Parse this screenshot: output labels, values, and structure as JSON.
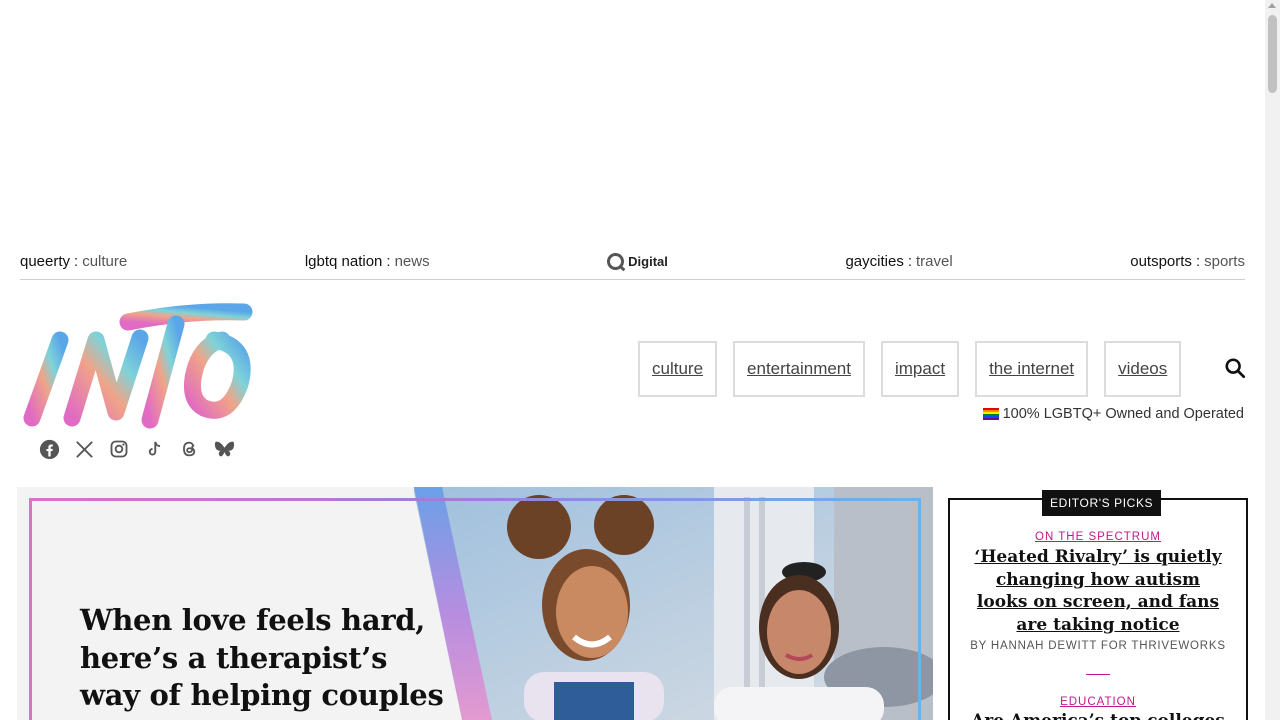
{
  "network": [
    {
      "brand": "queerty",
      "topic": "culture"
    },
    {
      "brand": "lgbtq nation",
      "topic": "news"
    },
    {
      "brand": "gaycities",
      "topic": "travel"
    },
    {
      "brand": "outsports",
      "topic": "sports"
    }
  ],
  "qdigital": {
    "text": "Digital"
  },
  "logo": {
    "text": "INTO"
  },
  "socials": [
    "facebook-icon",
    "x-icon",
    "instagram-icon",
    "tiktok-icon",
    "threads-icon",
    "bluesky-icon"
  ],
  "nav": {
    "items": [
      "culture",
      "entertainment",
      "impact",
      "the internet",
      "videos"
    ],
    "owned": "100% LGBTQ+ Owned and Operated"
  },
  "hero": {
    "title": "When love feels hard, here’s a therapist’s way of helping couples"
  },
  "editors_picks": {
    "label": "EDITOR'S PICKS",
    "items": [
      {
        "category": "ON THE SPECTRUM",
        "headline": "‘Heated Rivalry’ is quietly changing how autism looks on screen, and fans are taking notice",
        "byline": "BY HANNAH DEWITT FOR THRIVEWORKS"
      },
      {
        "category": "EDUCATION",
        "headline": "Are America’s top colleges"
      }
    ]
  },
  "colors": {
    "accent": "#c2188f",
    "border": "#dcdcdc"
  }
}
